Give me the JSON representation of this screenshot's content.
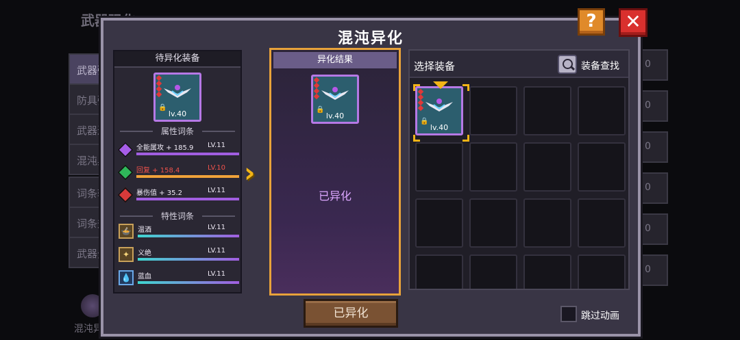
{
  "background": {
    "title": "武器强化",
    "tabs": [
      "武器强化",
      "防具强化",
      "武器进阶",
      "混沌异化",
      "词条转移",
      "词条升级",
      "武器分解"
    ],
    "side_values": [
      "0",
      "0",
      "0",
      "0",
      "0",
      "0"
    ],
    "bottom_label": "混沌异化"
  },
  "dialog": {
    "title": "混沌异化",
    "help_label": "?",
    "close_label": "✕"
  },
  "left": {
    "header": "待异化装备",
    "item_level": "lv.40",
    "attr_section": "属性词条",
    "attributes": [
      {
        "text": "全能属攻 + 185.9",
        "lv": "LV.11",
        "color": "#a65de8"
      },
      {
        "text": "回复 + 158.4",
        "lv": "LV.10",
        "color": "#2fb85a"
      },
      {
        "text": "暴伤值 + 35.2",
        "lv": "LV.11",
        "color": "#d83a3a"
      }
    ],
    "trait_section": "特性词条",
    "traits": [
      {
        "text": "温酒",
        "lv": "LV.11",
        "icon": "🍲"
      },
      {
        "text": "义绝",
        "lv": "LV.11",
        "icon": "✦"
      },
      {
        "text": "蓝血",
        "lv": "LV.11",
        "icon": "💧"
      }
    ]
  },
  "middle": {
    "header": "异化结果",
    "item_level": "lv.40",
    "status": "已异化"
  },
  "right": {
    "title": "选择装备",
    "search_label": "装备查找",
    "items": [
      {
        "level": "lv.40",
        "selected": true
      }
    ],
    "empty_slots": 15
  },
  "footer": {
    "confirm_label": "已异化",
    "skip_label": "跳过动画"
  }
}
